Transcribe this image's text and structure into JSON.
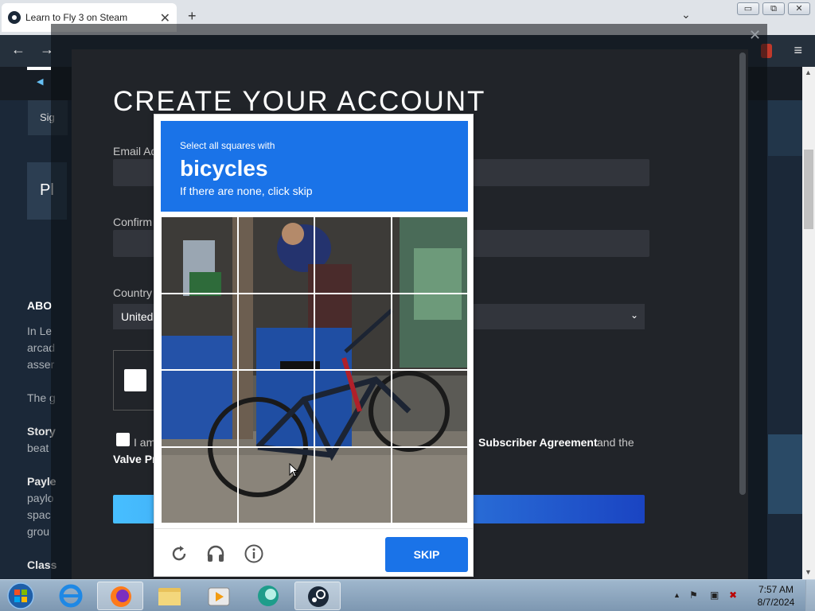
{
  "browser": {
    "tab_title": "Learn to Fly 3 on Steam",
    "tab_close": "✕",
    "new_tab": "+",
    "tab_menu": "⌄",
    "back": "←",
    "forward": "→",
    "menu": "≡",
    "win_min": "▭",
    "win_restore": "⧉",
    "win_close": "✕"
  },
  "background_page": {
    "sign_label": "Sig",
    "pl_label": "Pl",
    "about_label": "ABO",
    "lines": [
      "In Le",
      "arcad",
      "asser"
    ],
    "the_label": "The g",
    "story_label": "Story",
    "story_line": "beat",
    "payload_label": "Payle",
    "payload_lines": [
      "paylo",
      "spac",
      "grou"
    ],
    "class_label": "Class"
  },
  "modal": {
    "close": "✕",
    "title": "CREATE YOUR ACCOUNT",
    "email_label": "Email Ad",
    "confirm_label": "Confirm",
    "country_label": "Country",
    "country_value": "United",
    "chevron": "⌄",
    "agree_prefix": "I am",
    "agree_link": "Subscriber Agreement",
    "agree_suffix": "and the",
    "privacy_link": "Valve Pr"
  },
  "captcha": {
    "instruction": "Select all squares with",
    "object": "bicycles",
    "skip_note": "If there are none, click skip",
    "skip_label": "SKIP",
    "icons": [
      "reload-icon",
      "audio-icon",
      "info-icon"
    ],
    "accent": "#1a73e8"
  },
  "taskbar": {
    "time": "7:57 AM",
    "date": "8/7/2024",
    "tray_up": "▲"
  }
}
